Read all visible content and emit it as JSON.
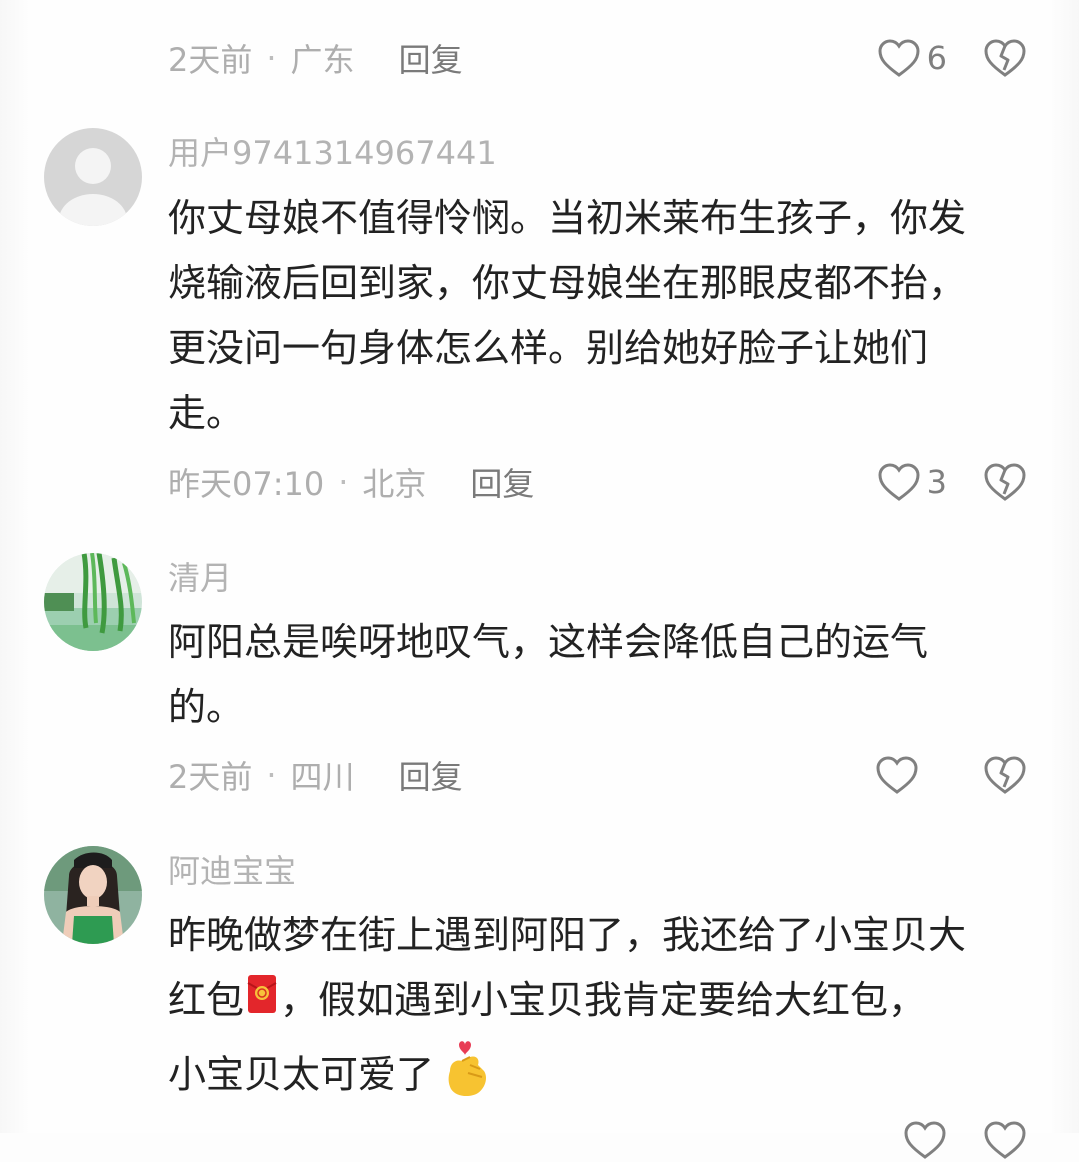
{
  "top_meta": {
    "time": "2天前",
    "location": "广东",
    "reply": "回复",
    "likes": "6"
  },
  "comments": [
    {
      "username": "用户9741314967441",
      "avatar": "default-user-avatar",
      "lines": [
        "你丈母娘不值得怜悯。当初米莱布生孩子，你发",
        "烧输液后回到家，你丈母娘坐在那眼皮都不抬，",
        "更没问一句身体怎么样。别给她好脸子让她们",
        "走。"
      ],
      "time": "昨天07:10",
      "location": "北京",
      "reply": "回复",
      "likes": "3"
    },
    {
      "username": "清月",
      "avatar": "willow-lake-avatar",
      "lines": [
        "阿阳总是唉呀地叹气，这样会降低自己的运气",
        "的。"
      ],
      "time": "2天前",
      "location": "四川",
      "reply": "回复",
      "likes": ""
    },
    {
      "username": "阿迪宝宝",
      "avatar": "woman-green-top-avatar",
      "lines": [
        "昨晚做梦在街上遇到阿阳了，我还给了小宝贝大",
        "红包",
        "，假如遇到小宝贝我肯定要给大红包，",
        "小宝贝太可爱了"
      ],
      "emojis": [
        "red-envelope-emoji",
        "finger-heart-emoji"
      ]
    }
  ],
  "colors": {
    "text": "#222222",
    "meta": "#aeaeae",
    "reply": "#7a7a7a",
    "icon": "#808080"
  }
}
